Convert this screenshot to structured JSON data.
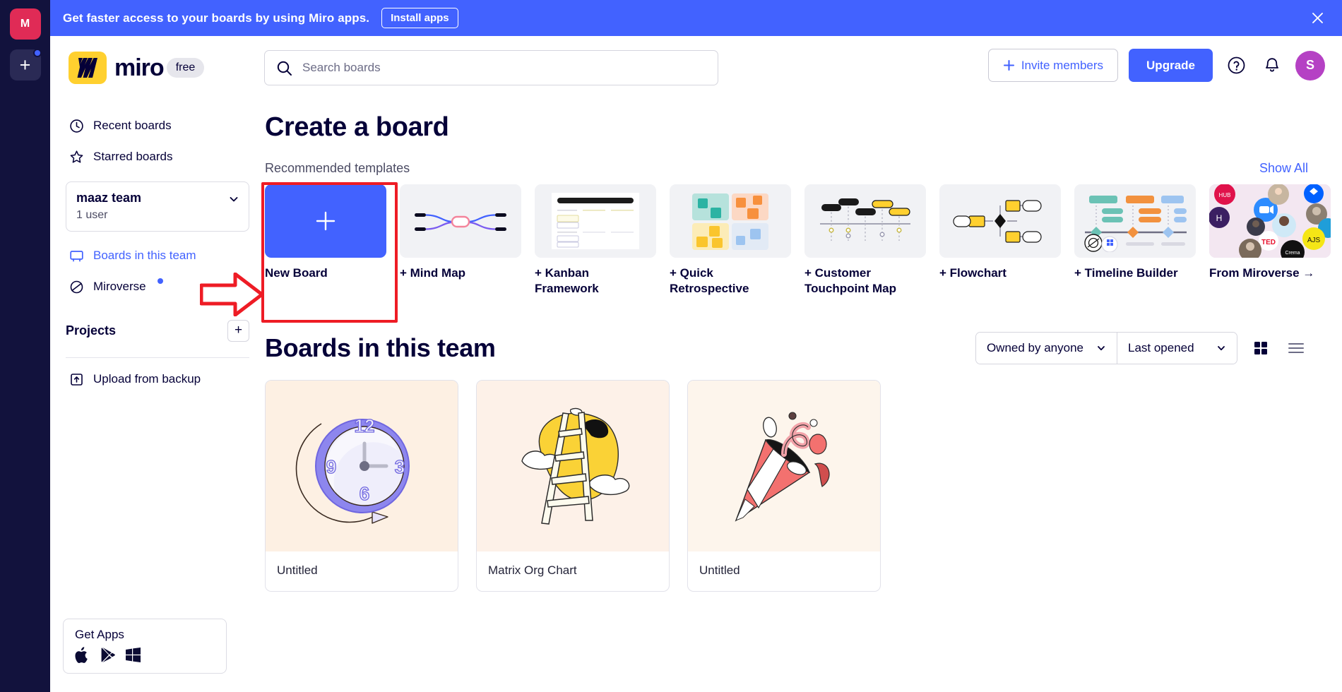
{
  "rail": {
    "team_initial": "M",
    "add_label": "+"
  },
  "banner": {
    "message": "Get faster access to your boards by using Miro apps.",
    "install_label": "Install apps",
    "close_icon": "close-icon",
    "bg_color": "#4262ff"
  },
  "header": {
    "logo_text": "miro",
    "plan_badge": "free",
    "search": {
      "value": "",
      "placeholder": "Search boards",
      "icon": "search-icon"
    },
    "invite_label": "Invite members",
    "upgrade_label": "Upgrade",
    "help_icon": "question-circle-icon",
    "notification_icon": "bell-icon",
    "avatar_initial": "S",
    "avatar_color": "#b541c4",
    "accent_color": "#4262ff"
  },
  "sidebar": {
    "items": [
      {
        "label": "Recent boards",
        "icon": "clock-icon"
      },
      {
        "label": "Starred boards",
        "icon": "star-icon"
      }
    ],
    "team": {
      "name": "maaz team",
      "users": "1 user",
      "caret": "chevron-down-icon"
    },
    "team_links": [
      {
        "label": "Boards in this team",
        "icon": "board-icon",
        "active": true
      },
      {
        "label": "Miroverse",
        "icon": "miroverse-icon",
        "badge": true
      }
    ],
    "projects_label": "Projects",
    "projects_add": "+",
    "upload_label": "Upload from backup",
    "upload_icon": "upload-icon",
    "get_apps": {
      "title": "Get Apps",
      "platforms": [
        "apple-icon",
        "google-play-icon",
        "windows-icon"
      ]
    }
  },
  "main": {
    "page_title": "Create a board",
    "templates_label": "Recommended templates",
    "show_all_label": "Show All",
    "templates": [
      {
        "label": "New Board",
        "thumb": "new-board",
        "selected": true
      },
      {
        "label": "+ Mind Map",
        "thumb": "mind-map"
      },
      {
        "label": "+ Kanban Framework",
        "thumb": "kanban"
      },
      {
        "label": "+ Quick Retrospective",
        "thumb": "retrospective"
      },
      {
        "label": "+ Customer Touchpoint Map",
        "thumb": "touchpoint"
      },
      {
        "label": "+ Flowchart",
        "thumb": "flowchart"
      },
      {
        "label": "+ Timeline Builder",
        "thumb": "timeline"
      },
      {
        "label": "From Miroverse →",
        "thumb": "miroverse"
      }
    ],
    "boards_title": "Boards in this team",
    "filter_owner": "Owned by anyone",
    "filter_sort": "Last opened",
    "grid_view_icon": "grid-view-icon",
    "list_view_icon": "list-view-icon",
    "boards": [
      {
        "name": "Untitled",
        "thumb": "clock"
      },
      {
        "name": "Matrix Org Chart",
        "thumb": "ladder"
      },
      {
        "name": "Untitled",
        "thumb": "party-popper"
      }
    ]
  },
  "annotation": {
    "highlight_color": "#ee1c25",
    "arrow": "right-block-arrow",
    "target": "New Board"
  }
}
